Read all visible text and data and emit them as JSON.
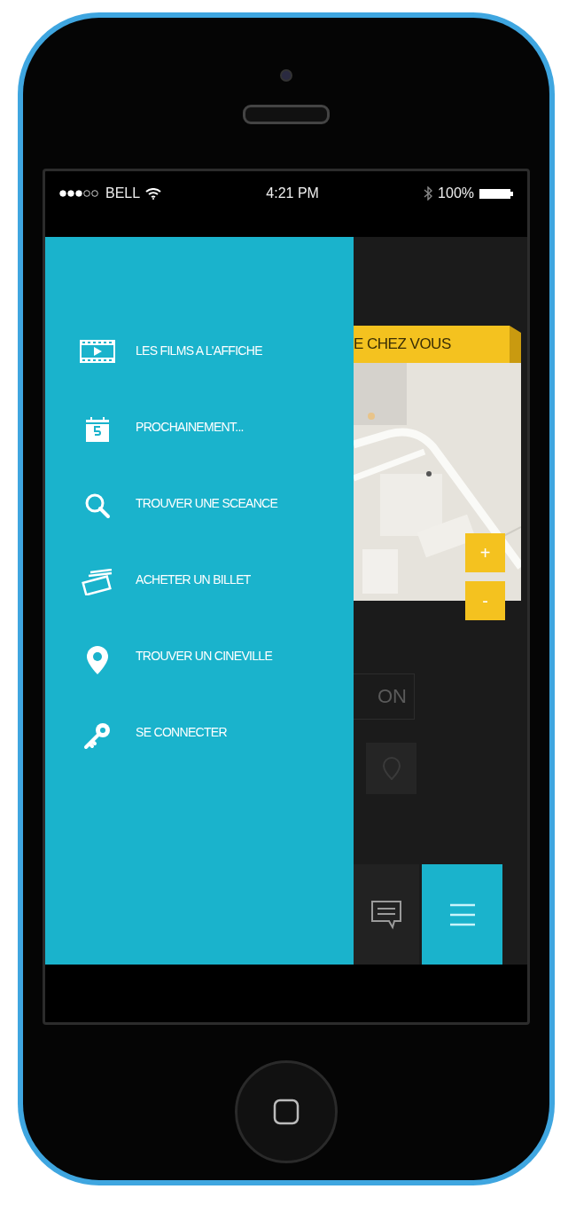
{
  "status_bar": {
    "carrier": "BELL",
    "time": "4:21 PM",
    "battery": "100%"
  },
  "drawer": {
    "items": [
      {
        "label": "LES FILMS A L'AFFICHE"
      },
      {
        "label": "PROCHAINEMENT..."
      },
      {
        "label": "TROUVER UNE SCEANCE"
      },
      {
        "label": "ACHETER UN BILLET"
      },
      {
        "label": "TROUVER UN CINEVILLE"
      },
      {
        "label": "SE CONNECTER"
      }
    ]
  },
  "main": {
    "banner": "E CHEZ VOUS",
    "zoom_in": "+",
    "zoom_out": "-",
    "button": "ON"
  }
}
